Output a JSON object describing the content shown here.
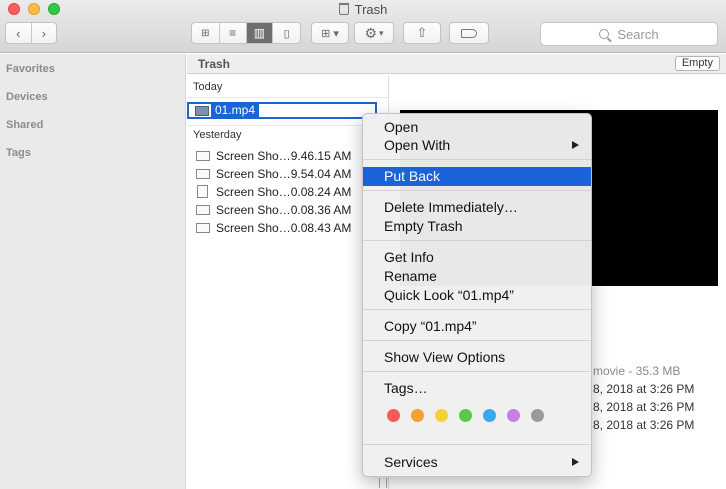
{
  "window": {
    "title": "Trash"
  },
  "toolbar": {
    "search_placeholder": "Search",
    "view_modes": [
      "icon-view",
      "list-view",
      "column-view",
      "cover-flow-view"
    ],
    "active_view": "column-view"
  },
  "sidebar": {
    "sections": [
      "Favorites",
      "Devices",
      "Shared",
      "Tags"
    ]
  },
  "pathbar": {
    "location": "Trash",
    "empty_label": "Empty"
  },
  "column": {
    "groups": [
      {
        "label": "Today",
        "items": [
          {
            "name": "01.mp4",
            "icon": "movie-icon",
            "selected": true
          }
        ]
      },
      {
        "label": "Yesterday",
        "items": [
          {
            "name": "Screen Sho…9.46.15 AM",
            "icon": "screenshot-icon"
          },
          {
            "name": "Screen Sho…9.54.04 AM",
            "icon": "screenshot-icon"
          },
          {
            "name": "Screen Sho…0.08.24 AM",
            "icon": "document-icon"
          },
          {
            "name": "Screen Sho…0.08.36 AM",
            "icon": "screenshot-icon"
          },
          {
            "name": "Screen Sho…0.08.43 AM",
            "icon": "screenshot-icon"
          }
        ]
      }
    ]
  },
  "preview": {
    "kind_size": "movie - 35.3 MB",
    "dates": [
      "8, 2018 at 3:26 PM",
      "8, 2018 at 3:26 PM",
      "8, 2018 at 3:26 PM"
    ]
  },
  "context_menu": {
    "open": "Open",
    "open_with": "Open With",
    "put_back": "Put Back",
    "delete_immediately": "Delete Immediately…",
    "empty_trash": "Empty Trash",
    "get_info": "Get Info",
    "rename": "Rename",
    "quick_look": "Quick Look “01.mp4”",
    "copy": "Copy “01.mp4”",
    "show_view_options": "Show View Options",
    "tags": "Tags…",
    "services": "Services",
    "highlighted": "put_back",
    "tag_colors": [
      {
        "name": "red",
        "hex": "#f85a55"
      },
      {
        "name": "orange",
        "hex": "#f6a030"
      },
      {
        "name": "yellow",
        "hex": "#f5cf3a"
      },
      {
        "name": "green",
        "hex": "#5ac84a"
      },
      {
        "name": "blue",
        "hex": "#3aa8f0"
      },
      {
        "name": "purple",
        "hex": "#c97ee0"
      },
      {
        "name": "gray",
        "hex": "#9a9a9a"
      }
    ]
  }
}
